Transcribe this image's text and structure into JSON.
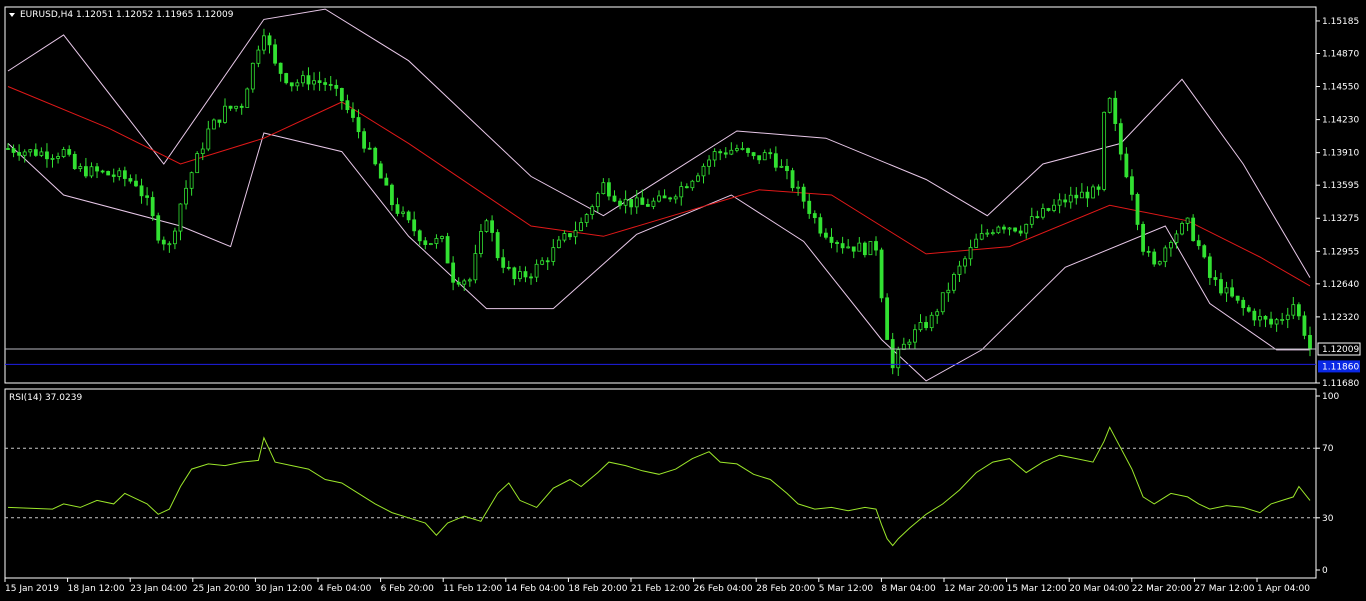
{
  "window": {
    "symbol_caption": "EURUSD,H4  1.12051 1.12052 1.11965 1.12009",
    "rsi_caption": "RSI(14) 37.0239"
  },
  "price_axis": {
    "labels": [
      "1.15185",
      "1.14870",
      "1.14550",
      "1.14230",
      "1.13910",
      "1.13595",
      "1.13275",
      "1.12955",
      "1.12640",
      "1.12320",
      "1.11680"
    ],
    "current_price": "1.12009",
    "line_price_label": "1.11860"
  },
  "rsi_axis": {
    "labels": [
      "100",
      "70",
      "30",
      "0"
    ]
  },
  "time_axis": {
    "labels": [
      "15 Jan 2019",
      "18 Jan 12:00",
      "23 Jan 04:00",
      "25 Jan 20:00",
      "30 Jan 12:00",
      "4 Feb 04:00",
      "6 Feb 20:00",
      "11 Feb 12:00",
      "14 Feb 04:00",
      "18 Feb 20:00",
      "21 Feb 12:00",
      "26 Feb 04:00",
      "28 Feb 20:00",
      "5 Mar 12:00",
      "8 Mar 04:00",
      "12 Mar 20:00",
      "15 Mar 12:00",
      "20 Mar 04:00",
      "22 Mar 20:00",
      "27 Mar 12:00",
      "1 Apr 04:00"
    ]
  },
  "colors": {
    "background": "#000000",
    "candle": "#32e132",
    "moving_average": "#e01818",
    "bollinger": "#e8c8e8",
    "rsi_line": "#9be62a",
    "bid_line": "#b8b8c0",
    "horizontal_line": "#1e1ee6",
    "price_tag_bg": "#0a28e6",
    "axis": "#ffffff"
  },
  "chart_data": [
    {
      "type": "candlestick",
      "symbol": "EURUSD",
      "timeframe": "H4",
      "ylim": [
        1.1168,
        1.1532
      ],
      "grid": false,
      "indicators": [
        "Moving Average",
        "Bollinger Bands"
      ],
      "close_path": [
        [
          0,
          1.1395
        ],
        [
          4,
          1.1392
        ],
        [
          8,
          1.139
        ],
        [
          10,
          1.1392
        ],
        [
          12,
          1.1375
        ],
        [
          16,
          1.1372
        ],
        [
          20,
          1.1368
        ],
        [
          23,
          1.1362
        ],
        [
          25,
          1.1342
        ],
        [
          27,
          1.1312
        ],
        [
          29,
          1.13
        ],
        [
          31,
          1.1342
        ],
        [
          33,
          1.1372
        ],
        [
          36,
          1.1412
        ],
        [
          39,
          1.1432
        ],
        [
          42,
          1.1438
        ],
        [
          45,
          1.1495
        ],
        [
          46,
          1.151
        ],
        [
          48,
          1.1475
        ],
        [
          51,
          1.1458
        ],
        [
          54,
          1.1462
        ],
        [
          57,
          1.1458
        ],
        [
          60,
          1.1442
        ],
        [
          63,
          1.1412
        ],
        [
          66,
          1.1378
        ],
        [
          69,
          1.1342
        ],
        [
          72,
          1.1322
        ],
        [
          75,
          1.1305
        ],
        [
          78,
          1.1305
        ],
        [
          80,
          1.127
        ],
        [
          83,
          1.1268
        ],
        [
          86,
          1.133
        ],
        [
          88,
          1.1292
        ],
        [
          91,
          1.1268
        ],
        [
          94,
          1.1275
        ],
        [
          97,
          1.129
        ],
        [
          100,
          1.1308
        ],
        [
          103,
          1.1322
        ],
        [
          107,
          1.136
        ],
        [
          110,
          1.1345
        ],
        [
          114,
          1.134
        ],
        [
          118,
          1.1345
        ],
        [
          122,
          1.1362
        ],
        [
          127,
          1.139
        ],
        [
          131,
          1.1395
        ],
        [
          134,
          1.1385
        ],
        [
          137,
          1.139
        ],
        [
          140,
          1.1368
        ],
        [
          143,
          1.1345
        ],
        [
          146,
          1.1318
        ],
        [
          150,
          1.1302
        ],
        [
          154,
          1.1298
        ],
        [
          156,
          1.13
        ],
        [
          157,
          1.1255
        ],
        [
          158,
          1.1215
        ],
        [
          159,
          1.1182
        ],
        [
          160,
          1.1195
        ],
        [
          162,
          1.1212
        ],
        [
          166,
          1.123
        ],
        [
          170,
          1.127
        ],
        [
          174,
          1.1305
        ],
        [
          178,
          1.1322
        ],
        [
          182,
          1.1318
        ],
        [
          186,
          1.1332
        ],
        [
          190,
          1.1345
        ],
        [
          194,
          1.1352
        ],
        [
          196,
          1.1352
        ],
        [
          197,
          1.1425
        ],
        [
          198,
          1.144
        ],
        [
          200,
          1.139
        ],
        [
          202,
          1.1355
        ],
        [
          204,
          1.13
        ],
        [
          206,
          1.128
        ],
        [
          209,
          1.131
        ],
        [
          212,
          1.1322
        ],
        [
          214,
          1.13
        ],
        [
          216,
          1.127
        ],
        [
          219,
          1.1255
        ],
        [
          222,
          1.124
        ],
        [
          225,
          1.123
        ],
        [
          227,
          1.1225
        ],
        [
          229,
          1.1232
        ],
        [
          231,
          1.1245
        ],
        [
          233,
          1.1218
        ],
        [
          234,
          1.1201
        ]
      ],
      "moving_average_path": [
        [
          0,
          1.1455
        ],
        [
          18,
          1.1415
        ],
        [
          31,
          1.138
        ],
        [
          46,
          1.1405
        ],
        [
          60,
          1.144
        ],
        [
          72,
          1.14
        ],
        [
          94,
          1.132
        ],
        [
          107,
          1.131
        ],
        [
          135,
          1.1355
        ],
        [
          148,
          1.135
        ],
        [
          165,
          1.1293
        ],
        [
          180,
          1.13
        ],
        [
          198,
          1.134
        ],
        [
          212,
          1.1325
        ],
        [
          225,
          1.129
        ],
        [
          234,
          1.1262
        ]
      ],
      "bollinger_upper_path": [
        [
          0,
          1.147
        ],
        [
          10,
          1.1505
        ],
        [
          28,
          1.138
        ],
        [
          46,
          1.152
        ],
        [
          57,
          1.153
        ],
        [
          72,
          1.148
        ],
        [
          94,
          1.1368
        ],
        [
          107,
          1.133
        ],
        [
          131,
          1.1412
        ],
        [
          147,
          1.1405
        ],
        [
          165,
          1.1365
        ],
        [
          176,
          1.133
        ],
        [
          186,
          1.138
        ],
        [
          200,
          1.14
        ],
        [
          211,
          1.1462
        ],
        [
          222,
          1.138
        ],
        [
          234,
          1.127
        ]
      ],
      "bollinger_lower_path": [
        [
          0,
          1.14
        ],
        [
          10,
          1.135
        ],
        [
          31,
          1.132
        ],
        [
          40,
          1.13
        ],
        [
          46,
          1.141
        ],
        [
          60,
          1.1392
        ],
        [
          72,
          1.131
        ],
        [
          86,
          1.124
        ],
        [
          98,
          1.124
        ],
        [
          113,
          1.1312
        ],
        [
          130,
          1.135
        ],
        [
          143,
          1.1305
        ],
        [
          157,
          1.121
        ],
        [
          165,
          1.117
        ],
        [
          175,
          1.12
        ],
        [
          190,
          1.128
        ],
        [
          208,
          1.132
        ],
        [
          216,
          1.1245
        ],
        [
          228,
          1.12
        ],
        [
          234,
          1.12
        ]
      ],
      "bid_line": 1.12009,
      "horizontal_line": 1.1186
    },
    {
      "type": "line",
      "title": "RSI(14) 37.0239",
      "ylim": [
        0,
        100
      ],
      "levels": [
        70,
        30
      ],
      "series": [
        {
          "values_path": [
            [
              0,
              36
            ],
            [
              8,
              35
            ],
            [
              10,
              38
            ],
            [
              13,
              36
            ],
            [
              16,
              40
            ],
            [
              19,
              38
            ],
            [
              21,
              44
            ],
            [
              23,
              41
            ],
            [
              25,
              38
            ],
            [
              27,
              32
            ],
            [
              29,
              35
            ],
            [
              31,
              48
            ],
            [
              33,
              58
            ],
            [
              36,
              61
            ],
            [
              39,
              60
            ],
            [
              42,
              62
            ],
            [
              45,
              63
            ],
            [
              46,
              76
            ],
            [
              48,
              62
            ],
            [
              51,
              60
            ],
            [
              54,
              58
            ],
            [
              57,
              52
            ],
            [
              60,
              50
            ],
            [
              63,
              44
            ],
            [
              66,
              38
            ],
            [
              69,
              33
            ],
            [
              72,
              30
            ],
            [
              75,
              27
            ],
            [
              77,
              20
            ],
            [
              79,
              27
            ],
            [
              82,
              31
            ],
            [
              85,
              28
            ],
            [
              88,
              44
            ],
            [
              90,
              50
            ],
            [
              92,
              40
            ],
            [
              95,
              36
            ],
            [
              98,
              47
            ],
            [
              101,
              52
            ],
            [
              103,
              48
            ],
            [
              106,
              56
            ],
            [
              108,
              62
            ],
            [
              111,
              60
            ],
            [
              114,
              57
            ],
            [
              117,
              55
            ],
            [
              120,
              58
            ],
            [
              123,
              64
            ],
            [
              126,
              68
            ],
            [
              128,
              62
            ],
            [
              131,
              61
            ],
            [
              134,
              55
            ],
            [
              137,
              52
            ],
            [
              140,
              44
            ],
            [
              142,
              38
            ],
            [
              145,
              35
            ],
            [
              148,
              36
            ],
            [
              151,
              34
            ],
            [
              154,
              36
            ],
            [
              156,
              35
            ],
            [
              157,
              26
            ],
            [
              158,
              18
            ],
            [
              159,
              14
            ],
            [
              160,
              18
            ],
            [
              162,
              24
            ],
            [
              165,
              32
            ],
            [
              168,
              38
            ],
            [
              171,
              46
            ],
            [
              174,
              56
            ],
            [
              177,
              62
            ],
            [
              180,
              64
            ],
            [
              183,
              56
            ],
            [
              186,
              62
            ],
            [
              189,
              66
            ],
            [
              192,
              64
            ],
            [
              195,
              62
            ],
            [
              197,
              74
            ],
            [
              198,
              82
            ],
            [
              200,
              70
            ],
            [
              202,
              58
            ],
            [
              204,
              42
            ],
            [
              206,
              38
            ],
            [
              209,
              44
            ],
            [
              212,
              42
            ],
            [
              214,
              38
            ],
            [
              216,
              35
            ],
            [
              219,
              37
            ],
            [
              222,
              36
            ],
            [
              225,
              33
            ],
            [
              227,
              38
            ],
            [
              229,
              40
            ],
            [
              231,
              42
            ],
            [
              232,
              48
            ],
            [
              234,
              40
            ]
          ]
        }
      ]
    }
  ]
}
